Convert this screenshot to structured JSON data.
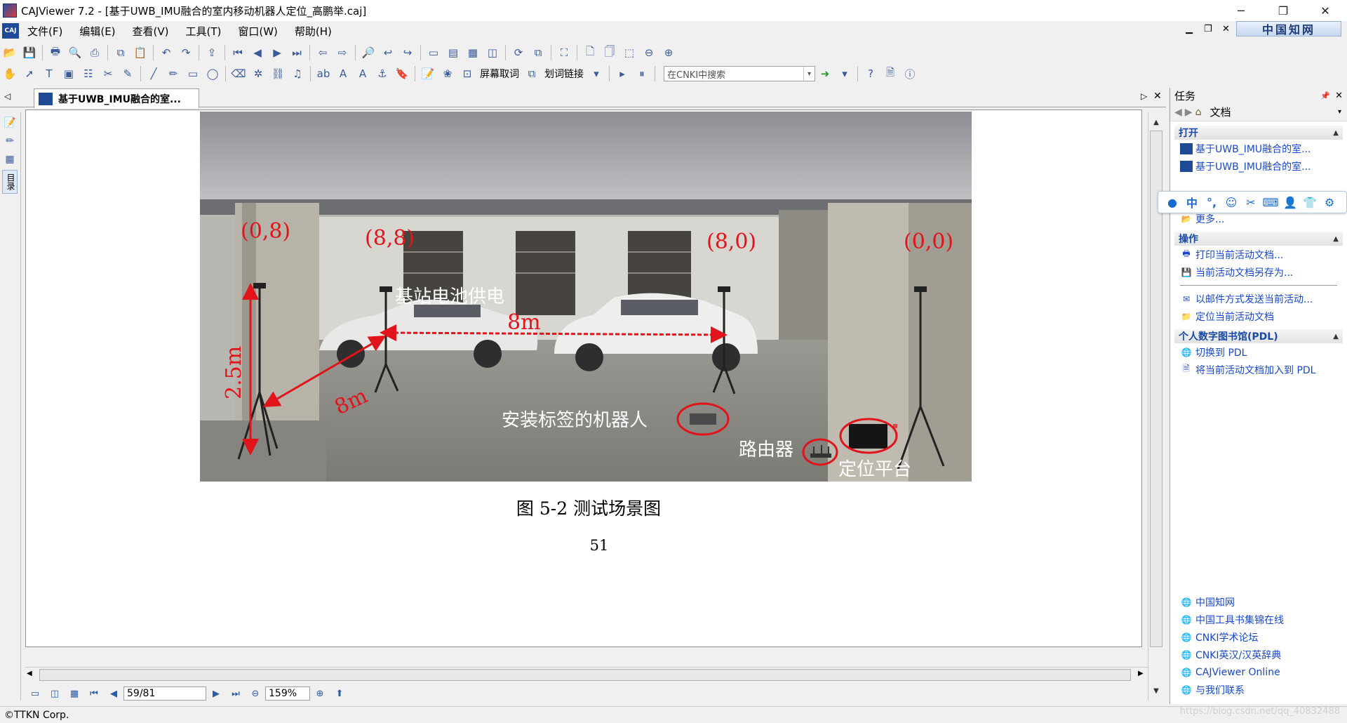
{
  "window": {
    "title": "CAJViewer 7.2 - [基于UWB_IMU融合的室内移动机器人定位_高鹏举.caj]",
    "minimize": "─",
    "maximize": "❐",
    "close": "✕"
  },
  "menu": {
    "items": [
      "文件(F)",
      "编辑(E)",
      "查看(V)",
      "工具(T)",
      "窗口(W)",
      "帮助(H)"
    ],
    "brand": "中国知网"
  },
  "toolbar2": {
    "mask_label": "屏幕取词",
    "link_label": "划词链接",
    "search_placeholder": "在CNKI中搜索"
  },
  "tab": {
    "label": "基于UWB_IMU融合的室..."
  },
  "leftbar": {
    "catalog_label": "目录"
  },
  "document": {
    "figure": {
      "labels": {
        "c08": "(0,8)",
        "c88": "(8,8)",
        "c80": "(8,0)",
        "c00": "(0,0)",
        "base_power": "基站电池供电",
        "dist_top": "8m",
        "dist_diag": "8m",
        "height": "2.5m",
        "robot": "安装标签的机器人",
        "router": "路由器",
        "platform": "定位平台"
      },
      "colors": {
        "annotation": "#e0141a"
      }
    },
    "caption": "图  5-2  测试场景图",
    "page_number": "51"
  },
  "navbar": {
    "page_value": "59/81",
    "zoom_value": "159%"
  },
  "status": {
    "copyright": "©TTKN Corp.",
    "watermark": "https://blog.csdn.net/qq_40832488"
  },
  "taskpane": {
    "title": "任务",
    "doc_label": "文档",
    "open_section": "打开",
    "open_items": [
      "基于UWB_IMU融合的室...",
      "基于UWB_IMU融合的室...",
      "更多..."
    ],
    "ops_section": "操作",
    "ops_items": [
      "打印当前活动文档...",
      "当前活动文档另存为...",
      "以邮件方式发送当前活动...",
      "定位当前活动文档"
    ],
    "pdl_section": "个人数字图书馆(PDL)",
    "pdl_items": [
      "切换到 PDL",
      "将当前活动文档加入到 PDL"
    ],
    "links": [
      "中国知网",
      "中国工具书集锦在线",
      "CNKI学术论坛",
      "CNKI英汉/汉英辞典",
      "CAJViewer Online",
      "与我们联系"
    ]
  }
}
